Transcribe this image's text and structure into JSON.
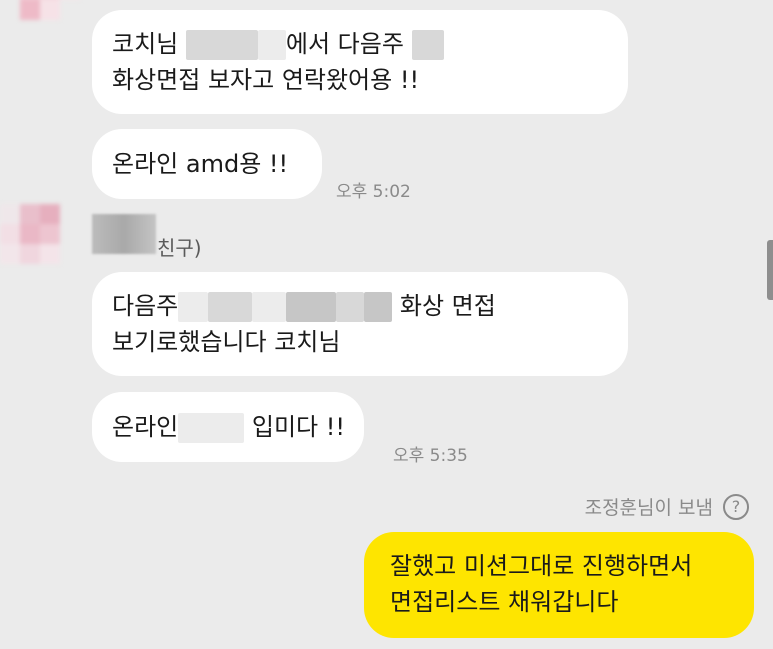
{
  "chat": {
    "messages": [
      {
        "line1_pre": "코치님",
        "line1_mid": "에서 다음주",
        "line1_post": "",
        "line2": "화상면접 보자고 연락왔어용 !!"
      },
      {
        "text": "온라인 amd용 !!",
        "time": "오후 5:02"
      }
    ],
    "friend": {
      "name_suffix": "친구)"
    },
    "friend_messages": [
      {
        "line1_pre": "다음주",
        "line1_post": "화상 면접",
        "line2": "보기로했습니다 코치님"
      },
      {
        "text_pre": "온라인",
        "text_post": "입미다 !!",
        "time": "오후 5:35"
      }
    ],
    "sent_note": {
      "label": "조정훈님이 보냄",
      "help_icon": "?"
    },
    "my_message": {
      "line1": "잘했고 미션그대로 진행하면서",
      "line2": "면접리스트 채워갑니다"
    }
  },
  "colors": {
    "background": "#ebebeb",
    "bubble_incoming": "#ffffff",
    "bubble_outgoing": "#fee500",
    "meta_text": "#8a8a8a"
  }
}
